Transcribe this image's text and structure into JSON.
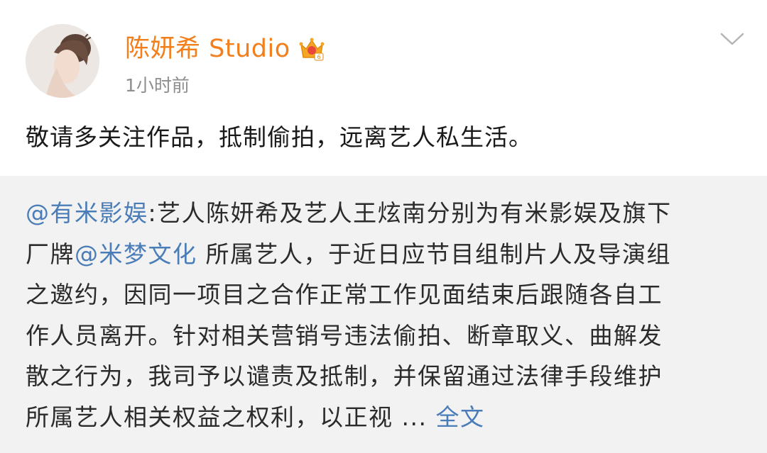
{
  "post": {
    "author": "陈妍希 Studio",
    "badge_icon": "vip-crown-icon",
    "time": "1小时前",
    "menu_icon": "chevron-down-icon",
    "text": "敬请多关注作品，抵制偷拍，远离艺人私生活。"
  },
  "repost": {
    "mention_author": "@有米影娱",
    "line1_rest": ":艺人陈妍希及艺人王炫南分别为有米影娱及旗下",
    "line2_before": "厂牌",
    "mention_inline": "@米梦文化",
    "line2_after": " 所属艺人，于近日应节目组制片人及导演组",
    "line3": "之邀约，因同一项目之合作正常工作见面结束后跟随各自工",
    "line4": "作人员离开。针对相关营销号违法偷拍、断章取义、曲解发",
    "line5": "散之行为，我司予以谴责及抵制，并保留通过法律手段维护",
    "line6": "所属艺人相关权益之权利，以正视 ... ",
    "expand_label": "全文"
  },
  "colors": {
    "author": "#f27f1c",
    "link": "#4a7db8",
    "repost_bg": "#f2f2f2",
    "time": "#8e8e8e"
  }
}
